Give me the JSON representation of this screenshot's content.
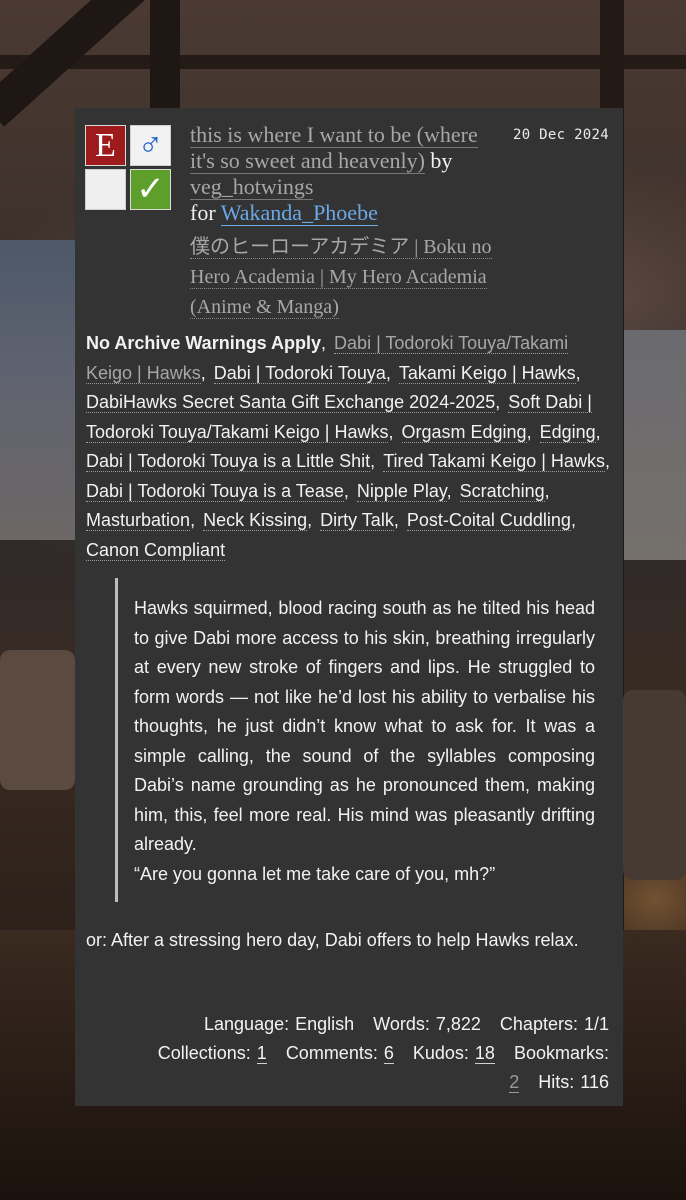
{
  "work": {
    "date": "20 Dec 2024",
    "title": "this is where I want to be (where it's so sweet and heavenly)",
    "by_word": "by",
    "author": "veg_hotwings",
    "for_word": "for",
    "recipient": "Wakanda_Phoebe",
    "fandom": "僕のヒーローアカデミア | Boku no Hero Academia | My Hero Academia (Anime & Manga)",
    "icons": {
      "rating": "E",
      "category": "♂",
      "warnings": "",
      "complete": "✓",
      "rating_color": "#9e1b1b",
      "complete_color": "#5e9e2b",
      "category_color": "#1e63c8"
    }
  },
  "tags": [
    {
      "text": "No Archive Warnings Apply",
      "kind": "warning"
    },
    {
      "text": "Dabi | Todoroki Touya/Takami Keigo | Hawks",
      "kind": "relationship"
    },
    {
      "text": "Dabi | Todoroki Touya",
      "kind": "character"
    },
    {
      "text": "Takami Keigo | Hawks",
      "kind": "character"
    },
    {
      "text": "DabiHawks Secret Santa Gift Exchange 2024-2025",
      "kind": "freeform"
    },
    {
      "text": "Soft Dabi | Todoroki Touya/Takami Keigo | Hawks",
      "kind": "freeform"
    },
    {
      "text": "Orgasm Edging",
      "kind": "freeform"
    },
    {
      "text": "Edging",
      "kind": "freeform"
    },
    {
      "text": "Dabi | Todoroki Touya is a Little Shit",
      "kind": "freeform"
    },
    {
      "text": "Tired Takami Keigo | Hawks",
      "kind": "freeform"
    },
    {
      "text": "Dabi | Todoroki Touya is a Tease",
      "kind": "freeform"
    },
    {
      "text": "Nipple Play",
      "kind": "freeform"
    },
    {
      "text": "Scratching",
      "kind": "freeform"
    },
    {
      "text": "Masturbation",
      "kind": "freeform"
    },
    {
      "text": "Neck Kissing",
      "kind": "freeform"
    },
    {
      "text": "Dirty Talk",
      "kind": "freeform"
    },
    {
      "text": "Post-Coital Cuddling",
      "kind": "freeform"
    },
    {
      "text": "Canon Compliant",
      "kind": "freeform"
    }
  ],
  "summary": {
    "quote": "Hawks squirmed, blood racing south as he tilted his head to give Dabi more access to his skin, breathing irregularly at every new stroke of fingers and lips. He struggled to form words — not like he’d lost his ability to verbalise his thoughts, he just didn’t know what to ask for. It was a simple calling, the sound of the syllables composing Dabi’s name grounding as he pronounced them, making him, this, feel more real. His mind was pleasantly drifting already.",
    "quote_line": "“Are you gonna let me take care of you, mh?”",
    "text": "or: After a stressing hero day, Dabi offers to help Hawks relax."
  },
  "stats": {
    "language_label": "Language:",
    "language": "English",
    "words_label": "Words:",
    "words": "7,822",
    "chapters_label": "Chapters:",
    "chapters": "1/1",
    "collections_label": "Collections:",
    "collections": "1",
    "comments_label": "Comments:",
    "comments": "6",
    "kudos_label": "Kudos:",
    "kudos": "18",
    "bookmarks_label": "Bookmarks:",
    "bookmarks": "2",
    "hits_label": "Hits:",
    "hits": "116"
  }
}
